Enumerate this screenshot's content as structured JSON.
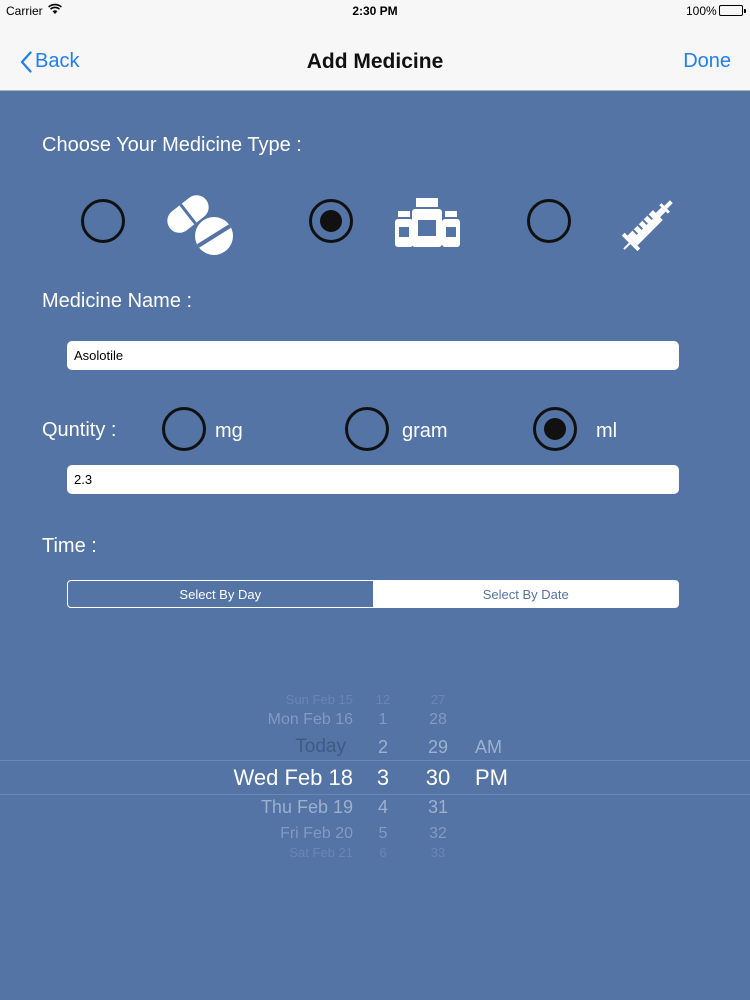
{
  "status_bar": {
    "carrier": "Carrier",
    "time": "2:30 PM",
    "battery": "100%"
  },
  "nav": {
    "back_label": "Back",
    "title": "Add Medicine",
    "done_label": "Done"
  },
  "medicine_type": {
    "label": "Choose Your Medicine Type :",
    "options": [
      {
        "icon": "pills-icon",
        "checked": false
      },
      {
        "icon": "bottles-icon",
        "checked": true
      },
      {
        "icon": "syringe-icon",
        "checked": false
      }
    ]
  },
  "medicine_name": {
    "label": "Medicine Name :",
    "value": "Asolotile"
  },
  "quantity": {
    "label": "Quntity :",
    "units": [
      {
        "label": "mg",
        "checked": false
      },
      {
        "label": "gram",
        "checked": false
      },
      {
        "label": "ml",
        "checked": true
      }
    ],
    "value": "2.3"
  },
  "time": {
    "label": "Time :",
    "segments": [
      {
        "label": "Select By Day",
        "active": true
      },
      {
        "label": "Select By Date",
        "active": false
      }
    ]
  },
  "picker": {
    "days": [
      "Sun Feb 15",
      "Mon Feb 16",
      "Today",
      "Wed Feb 18",
      "Thu Feb 19",
      "Fri Feb 20",
      "Sat Feb 21"
    ],
    "hours": [
      "12",
      "1",
      "2",
      "3",
      "4",
      "5",
      "6"
    ],
    "minutes": [
      "27",
      "28",
      "29",
      "30",
      "31",
      "32",
      "33"
    ],
    "ampm": [
      "AM",
      "PM"
    ],
    "selected": {
      "day": "Wed Feb 18",
      "hour": "3",
      "minute": "30",
      "ampm": "PM"
    }
  },
  "colors": {
    "background": "#5374a5",
    "nav_bar": "#f7f7f7",
    "accent": "#1f7ff2"
  }
}
